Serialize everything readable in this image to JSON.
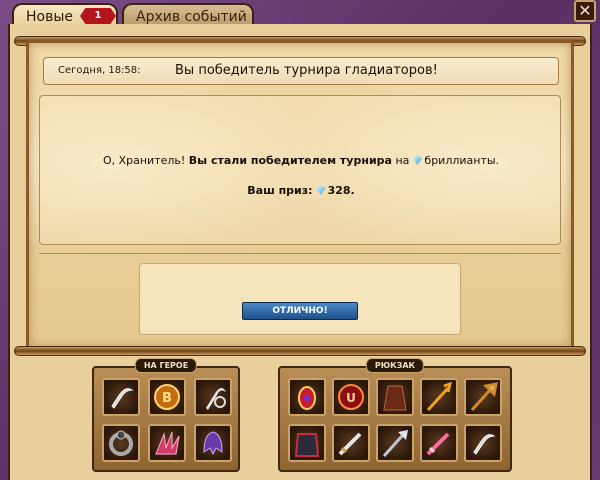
{
  "tabs": {
    "new_label": "Новые",
    "new_count": "1",
    "archive_label": "Архив событий"
  },
  "close": {
    "label": "✕"
  },
  "message": {
    "time": "Сегодня, 18:58:",
    "title": "Вы победитель турнира гладиаторов!",
    "greeting": "О, Хранитель!",
    "bold_text": "Вы стали победителем турнира",
    "after_bold": "на",
    "currency": "бриллианты.",
    "prize_label": "Ваш приз:",
    "prize_amount": "328",
    "prize_end": "."
  },
  "ok_button": {
    "label": "ОТЛИЧНО!"
  },
  "hero_panel": {
    "label": "НА ГЕРОЕ",
    "items": [
      "sickle-icon",
      "rune-b-icon",
      "scythe-icon",
      "ring-icon",
      "claw-icon",
      "helmet-icon"
    ]
  },
  "backpack_panel": {
    "label": "РЮКЗАК",
    "items": [
      "gem-amulet-icon",
      "rune-orb-icon",
      "robe-icon",
      "trident-icon",
      "spear-icon",
      "armor-icon",
      "sword-icon",
      "lance-icon",
      "pink-sword-icon",
      "sickle-icon"
    ]
  },
  "colors": {
    "frame": "#6b3f74",
    "parchment": "#e9cf9b",
    "badge": "#b4151a",
    "button": "#1d4f8a"
  }
}
